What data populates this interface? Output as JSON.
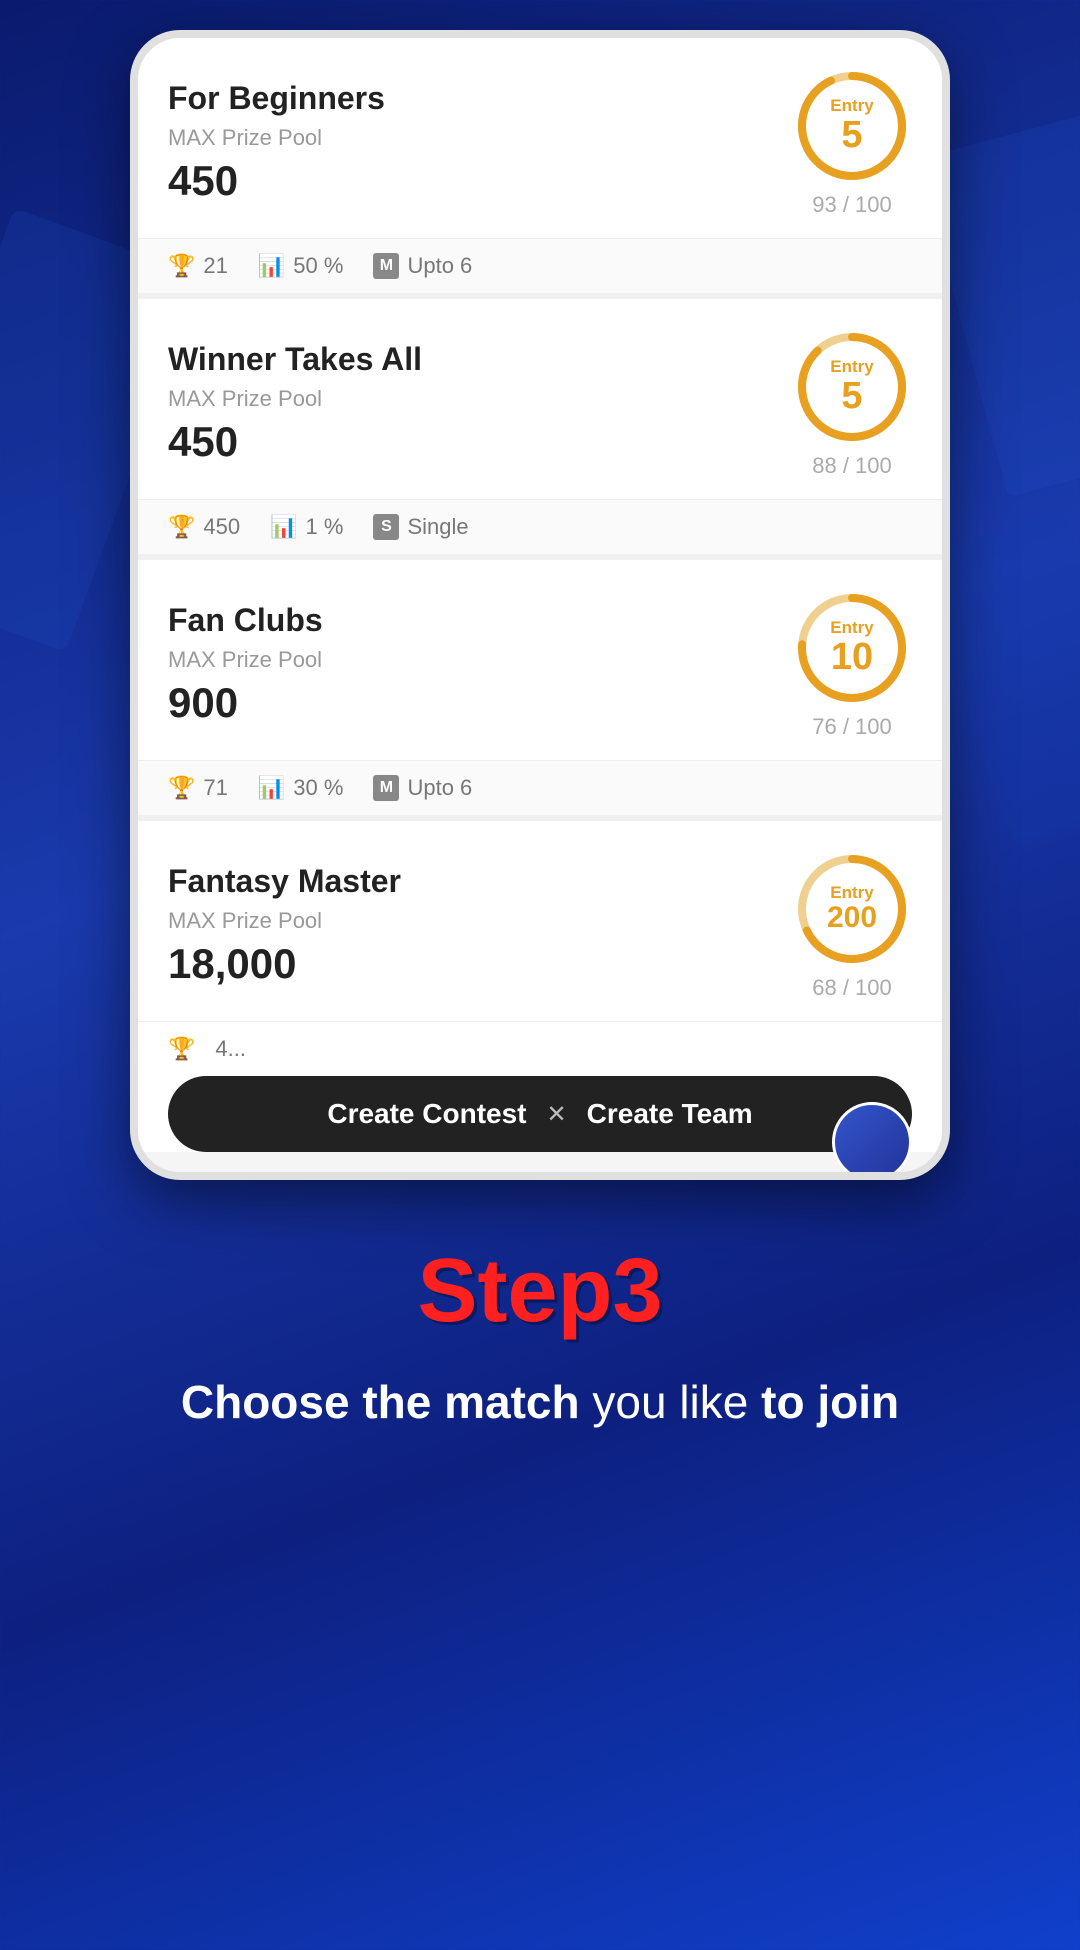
{
  "background": {
    "color_start": "#0a1a6e",
    "color_end": "#1040cc"
  },
  "contests": [
    {
      "id": "for-beginners",
      "title": "For Beginners",
      "prize_label": "MAX Prize Pool",
      "prize_value": "450",
      "entry": "5",
      "filled": 93,
      "total": 100,
      "stats": [
        {
          "icon": "🏆",
          "value": "21"
        },
        {
          "icon": "📊",
          "value": "50 %"
        },
        {
          "icon": "M",
          "value": "Upto 6"
        }
      ],
      "progress_pct": 93
    },
    {
      "id": "winner-takes-all",
      "title": "Winner Takes All",
      "prize_label": "MAX Prize Pool",
      "prize_value": "450",
      "entry": "5",
      "filled": 88,
      "total": 100,
      "stats": [
        {
          "icon": "🏆",
          "value": "450"
        },
        {
          "icon": "📊",
          "value": "1 %"
        },
        {
          "icon": "S",
          "value": "Single"
        }
      ],
      "progress_pct": 88
    },
    {
      "id": "fan-clubs",
      "title": "Fan Clubs",
      "prize_label": "MAX Prize Pool",
      "prize_value": "900",
      "entry": "10",
      "filled": 76,
      "total": 100,
      "stats": [
        {
          "icon": "🏆",
          "value": "71"
        },
        {
          "icon": "📊",
          "value": "30 %"
        },
        {
          "icon": "M",
          "value": "Upto 6"
        }
      ],
      "progress_pct": 76
    },
    {
      "id": "fantasy-master",
      "title": "Fantasy Master",
      "prize_label": "MAX Prize Pool",
      "prize_value": "18,000",
      "entry": "200",
      "filled": 68,
      "total": 100,
      "stats": [
        {
          "icon": "🏆",
          "value": "4..."
        },
        {
          "icon": "📊",
          "value": ""
        },
        {
          "icon": "",
          "value": ""
        }
      ],
      "progress_pct": 68
    }
  ],
  "action_bar": {
    "create_contest": "Create Contest",
    "divider": "✕",
    "create_team": "Create Team"
  },
  "bottom": {
    "step_label": "Step3",
    "subtitle_bold": "Choose the match",
    "subtitle_regular": " you like ",
    "subtitle_bold2": "to join"
  }
}
